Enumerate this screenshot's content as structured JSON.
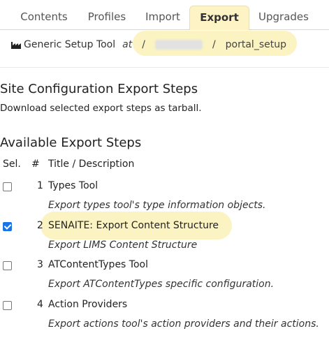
{
  "tabs": [
    {
      "label": "Contents",
      "active": false
    },
    {
      "label": "Profiles",
      "active": false
    },
    {
      "label": "Import",
      "active": false
    },
    {
      "label": "Export",
      "active": true
    },
    {
      "label": "Upgrades",
      "active": false
    }
  ],
  "breadcrumb": {
    "tool_icon": "factory-icon",
    "tool_label": "Generic Setup Tool",
    "at": "at",
    "sep": "/",
    "last": "portal_setup"
  },
  "heading": "Site Configuration Export Steps",
  "description": "Download selected export steps as tarball.",
  "available_heading": "Available Export Steps",
  "table": {
    "headers": {
      "sel": "Sel.",
      "num": "#",
      "title": "Title / Description"
    },
    "rows": [
      {
        "checked": false,
        "num": "1",
        "title": "Types Tool",
        "desc": "Export types tool's type information objects."
      },
      {
        "checked": true,
        "num": "2",
        "title": "SENAITE: Export Content Structure",
        "desc": "Export LIMS Content Structure"
      },
      {
        "checked": false,
        "num": "3",
        "title": "ATContentTypes Tool",
        "desc": "Export ATContentTypes specific configuration."
      },
      {
        "checked": false,
        "num": "4",
        "title": "Action Providers",
        "desc": "Export actions tool's action providers and their actions."
      }
    ]
  },
  "colors": {
    "highlight": "#fbf3c1",
    "checkbox_checked": "#1a73e8"
  }
}
